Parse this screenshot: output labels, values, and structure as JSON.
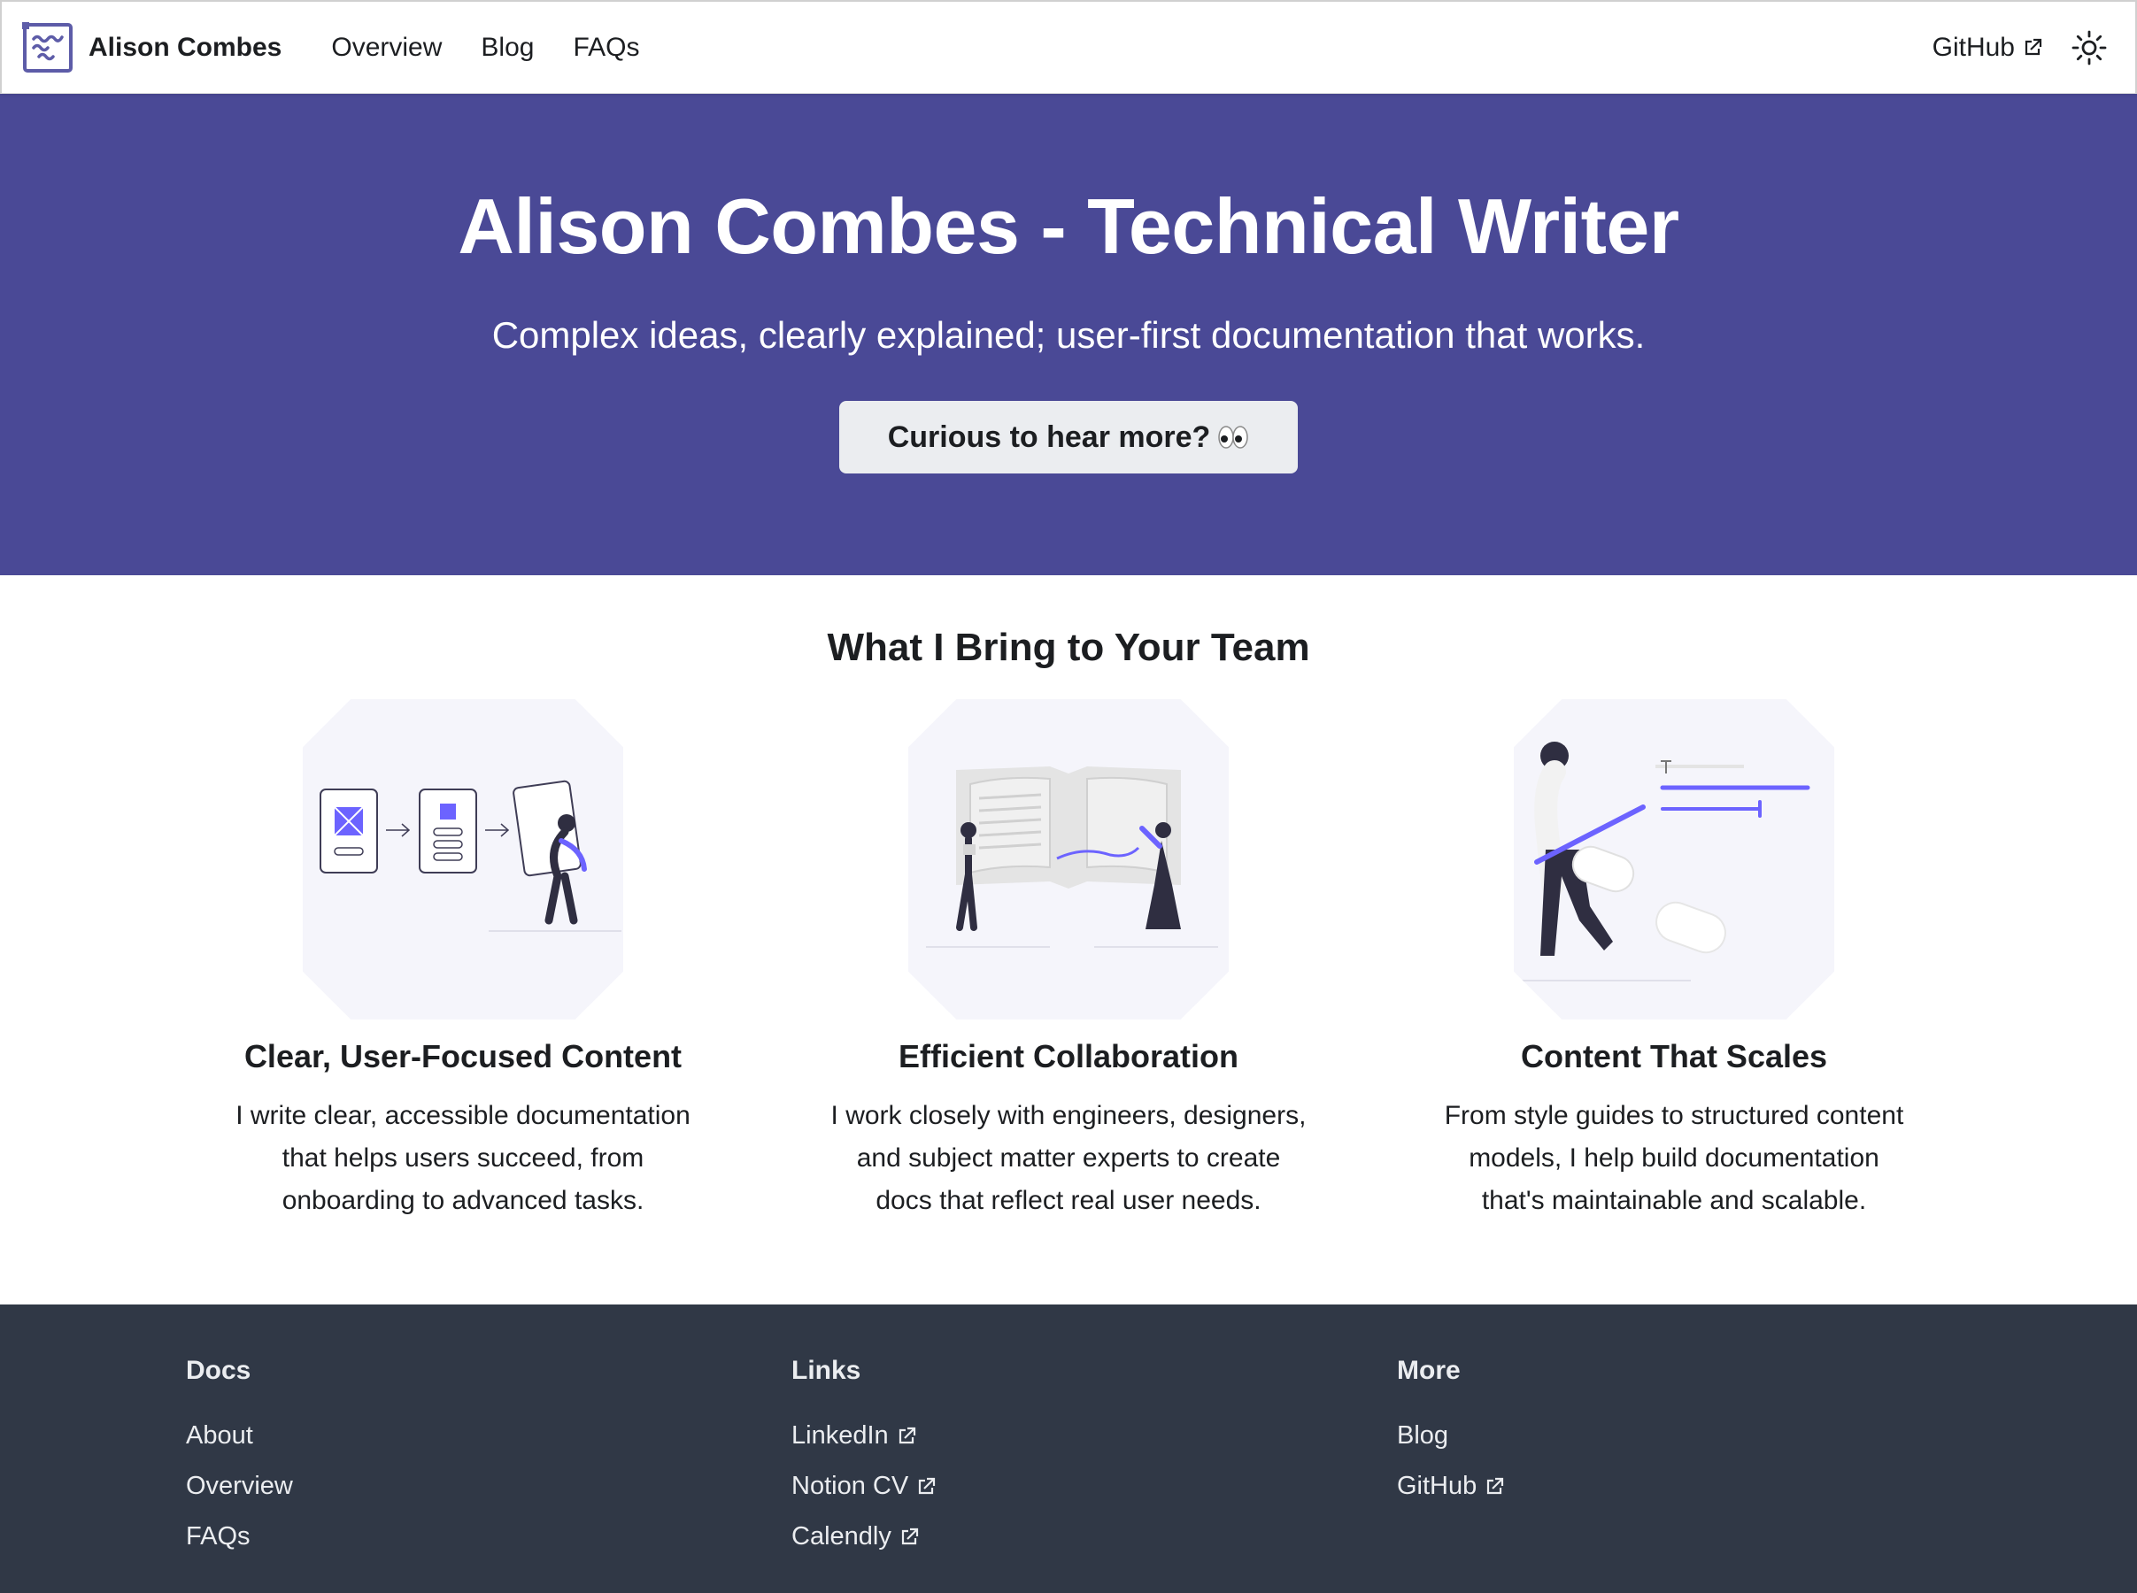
{
  "navbar": {
    "brand_title": "Alison Combes",
    "logo_icon": "wave-square-logo",
    "links": [
      "Overview",
      "Blog",
      "FAQs"
    ],
    "github_label": "GitHub",
    "theme_toggle_icon": "sun-icon"
  },
  "hero": {
    "title": "Alison Combes - Technical Writer",
    "subtitle": "Complex ideas, clearly explained; user-first documentation that works.",
    "button_label": "Curious to hear more?",
    "button_emoji": "eyes-emoji",
    "background_color": "#4a4996"
  },
  "features": {
    "heading": "What I Bring to Your Team",
    "items": [
      {
        "title": "Clear, User-Focused Content",
        "description": "I write clear, accessible documentation that helps users succeed, from onboarding to advanced tasks.",
        "illustration": "wireframe-flow-illustration"
      },
      {
        "title": "Efficient Collaboration",
        "description": "I work closely with engineers, designers, and subject matter experts to create docs that reflect real user needs.",
        "illustration": "open-book-collaboration-illustration"
      },
      {
        "title": "Content That Scales",
        "description": "From style guides to structured content models, I help build documentation that's maintainable and scalable.",
        "illustration": "text-editing-illustration"
      }
    ]
  },
  "footer": {
    "background_color": "#303846",
    "columns": [
      {
        "title": "Docs",
        "items": [
          "About",
          "Overview",
          "FAQs"
        ]
      },
      {
        "title": "Links",
        "items": [
          "LinkedIn",
          "Notion CV",
          "Calendly"
        ]
      },
      {
        "title": "More",
        "items": [
          "Blog",
          "GitHub"
        ]
      }
    ]
  }
}
